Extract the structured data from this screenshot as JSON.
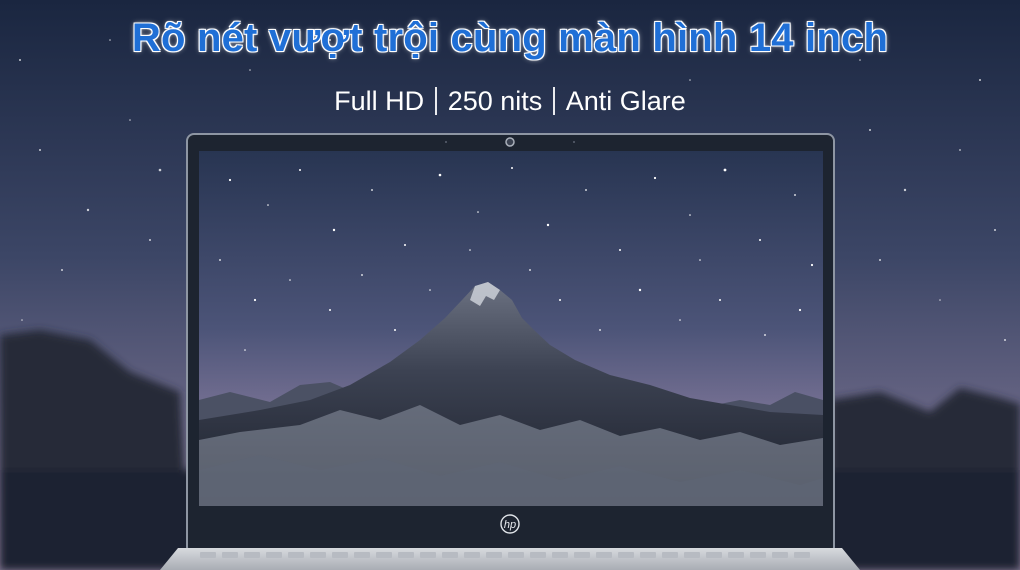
{
  "headline": "Rõ nét vượt trội cùng màn hình 14 inch",
  "specs": [
    "Full HD",
    "250 nits",
    "Anti Glare"
  ],
  "laptop_logo": "hp",
  "colors": {
    "headline": "#1f6fd6",
    "sky_top": "#1b2740",
    "sky_bottom": "#6d6a8a",
    "bezel": "#1d2430",
    "chassis": "#c9ccd1"
  }
}
